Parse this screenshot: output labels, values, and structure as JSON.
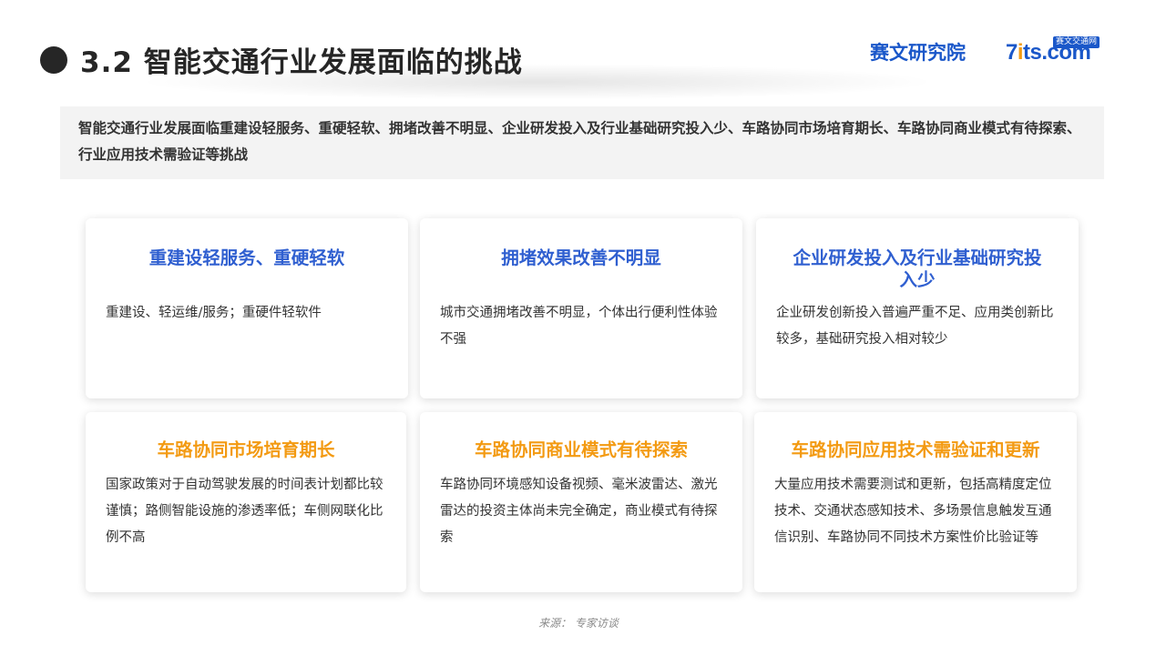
{
  "header": {
    "title": "3.2  智能交通行业发展面临的挑战",
    "logo_cn": "赛文研究院",
    "logo_en_seven": "7",
    "logo_en_i": "i",
    "logo_en_rest": "ts.com",
    "logo_badge": "赛文交通网"
  },
  "summary": {
    "text": "智能交通行业发展面临重建设轻服务、重硬轻软、拥堵改善不明显、企业研发投入及行业基础研究投入少、车路协同市场培育期长、车路协同商业模式有待探索、行业应用技术需验证等挑战"
  },
  "cards": [
    {
      "title": "重建设轻服务、重硬轻软",
      "body": "重建设、轻运维/服务；重硬件轻软件"
    },
    {
      "title": "拥堵效果改善不明显",
      "body": "城市交通拥堵改善不明显，个体出行便利性体验不强"
    },
    {
      "title": "企业研发投入及行业基础研究投入少",
      "body": "企业研发创新投入普遍严重不足、应用类创新比较多，基础研究投入相对较少"
    },
    {
      "title": "车路协同市场培育期长",
      "body": "国家政策对于自动驾驶发展的时间表计划都比较谨慎；路侧智能设施的渗透率低；车侧网联化比例不高"
    },
    {
      "title": "车路协同商业模式有待探索",
      "body": "车路协同环境感知设备视频、毫米波雷达、激光雷达的投资主体尚未完全确定，商业模式有待探索"
    },
    {
      "title": "车路协同应用技术需验证和更新",
      "body": "大量应用技术需要测试和更新，包括高精度定位技术、交通状态感知技术、多场景信息触发互通信识别、车路协同不同技术方案性价比验证等"
    }
  ],
  "source": "来源：  专家访谈",
  "colors": {
    "blue_title": "#2f5fd0",
    "orange_title": "#f39a12",
    "logo": "#1a57c9"
  }
}
